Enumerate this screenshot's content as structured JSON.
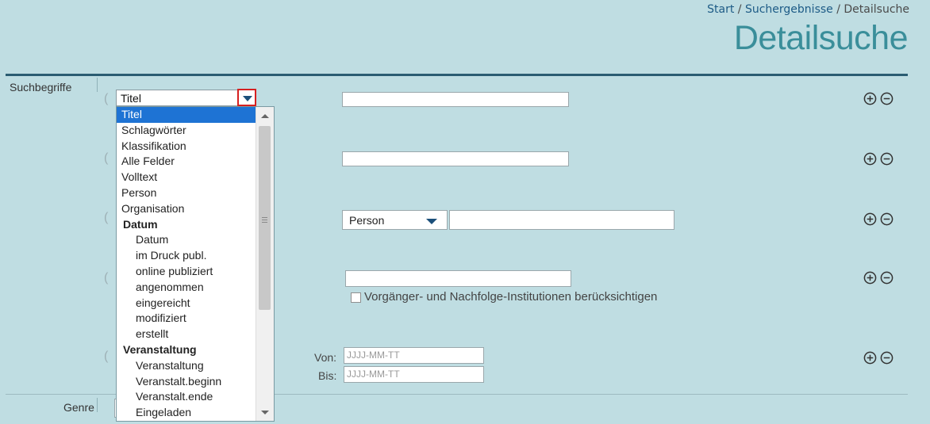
{
  "breadcrumb": {
    "start": "Start",
    "results": "Suchergebnisse",
    "current": "Detailsuche",
    "separator": "/"
  },
  "page_title": "Detailsuche",
  "sections": {
    "search_terms": "Suchbegriffe",
    "genre": "Genre"
  },
  "rows": [
    {
      "field_select": "Titel"
    },
    {
      "field_select": ""
    },
    {
      "person_select": "Person"
    },
    {
      "checkbox_label": "Vorgänger- und Nachfolge-Institutionen berücksichtigen",
      "checked": false
    },
    {
      "from_label": "Von:",
      "to_label": "Bis:",
      "from_placeholder": "JJJJ-MM-TT",
      "to_placeholder": "JJJJ-MM-TT"
    }
  ],
  "dropdown": {
    "selected": "Titel",
    "options": [
      {
        "label": "Titel",
        "kind": "selected"
      },
      {
        "label": "Schlagwörter",
        "kind": "option"
      },
      {
        "label": "Klassifikation",
        "kind": "option"
      },
      {
        "label": "Alle Felder",
        "kind": "option"
      },
      {
        "label": "Volltext",
        "kind": "option"
      },
      {
        "label": "Person",
        "kind": "option"
      },
      {
        "label": "Organisation",
        "kind": "option"
      },
      {
        "label": "Datum",
        "kind": "group"
      },
      {
        "label": "Datum",
        "kind": "sub"
      },
      {
        "label": "im Druck publ.",
        "kind": "sub"
      },
      {
        "label": "online publiziert",
        "kind": "sub"
      },
      {
        "label": "angenommen",
        "kind": "sub"
      },
      {
        "label": "eingereicht",
        "kind": "sub"
      },
      {
        "label": "modifiziert",
        "kind": "sub"
      },
      {
        "label": "erstellt",
        "kind": "sub"
      },
      {
        "label": "Veranstaltung",
        "kind": "group"
      },
      {
        "label": "Veranstaltung",
        "kind": "sub"
      },
      {
        "label": "Veranstalt.beginn",
        "kind": "sub"
      },
      {
        "label": "Veranstalt.ende",
        "kind": "sub"
      },
      {
        "label": "Eingeladen",
        "kind": "sub"
      }
    ]
  },
  "icons": {
    "add": "plus-circle-icon",
    "remove": "minus-circle-icon",
    "caret": "caret-down-icon"
  },
  "colors": {
    "background": "#bfdde2",
    "title": "#3a8e9a",
    "link": "#1d5b86",
    "rule": "#2a5c72",
    "selected": "#1e73d4",
    "highlight_border": "#d62020"
  }
}
